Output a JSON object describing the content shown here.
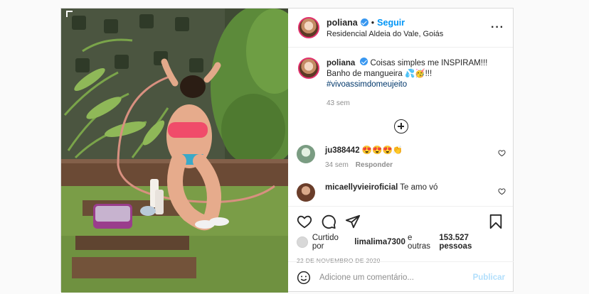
{
  "post": {
    "author": "poliana",
    "follow_label": "Seguir",
    "separator": "•",
    "location": "Residencial Aldeia do Vale, Goiás",
    "more_icon": "more-horizontal-icon",
    "more_label": "···"
  },
  "caption": {
    "username": "poliana",
    "line1": "Coisas simples me INSPIRAM!!!",
    "line2": "Banho de mangueira 💦🥳!!!",
    "hashtag": "#vivoassimdomeujeito",
    "time": "43 sem"
  },
  "load_more_icon": "plus-circle-icon",
  "comments": [
    {
      "username": "ju388442",
      "text": "😍😍😍👏",
      "time": "34 sem",
      "reply_label": "Responder"
    },
    {
      "username": "micaellyvieiroficial",
      "text": "Te amo vó"
    }
  ],
  "actions": {
    "like_icon": "heart-icon",
    "comment_icon": "comment-icon",
    "share_icon": "share-icon",
    "save_icon": "bookmark-icon"
  },
  "likes": {
    "prefix": "Curtido por",
    "user": "limalima7300",
    "middle": "e outras",
    "count": "153.527 pessoas"
  },
  "date": "22 DE NOVEMBRO DE 2020",
  "add_comment": {
    "placeholder": "Adicione um comentário...",
    "publish_label": "Publicar"
  },
  "colors": {
    "accent": "#0095f6",
    "verified": "#3897f0",
    "publish_disabled": "#b2dffc"
  }
}
